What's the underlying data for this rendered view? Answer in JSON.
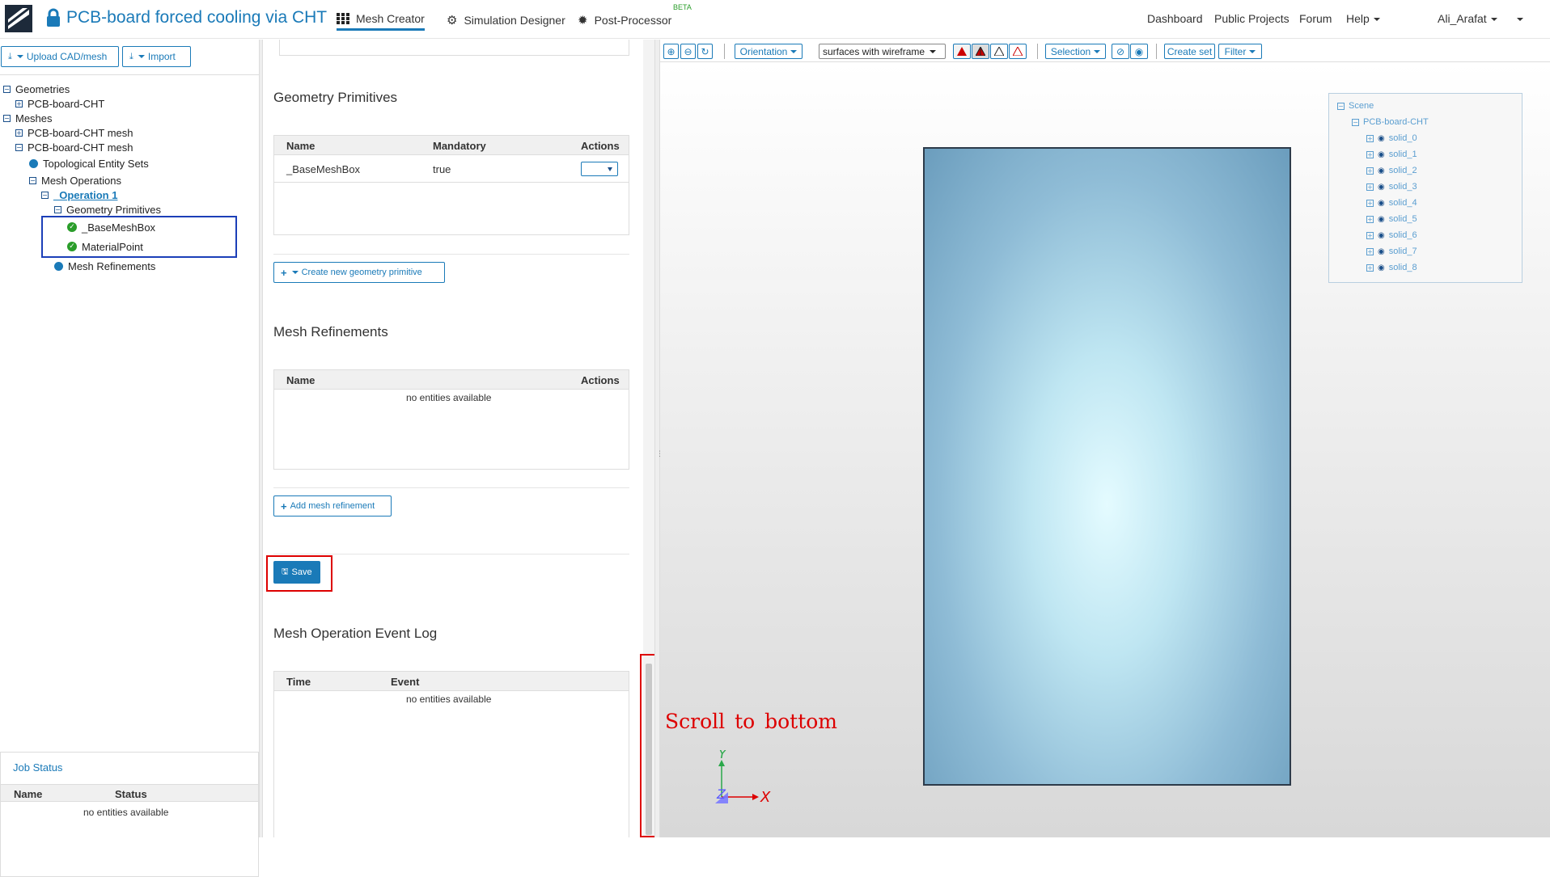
{
  "app": {
    "project_title": "PCB-board forced cooling via CHT",
    "tabs": [
      {
        "label": "Mesh Creator",
        "icon": "grid-icon",
        "active": true
      },
      {
        "label": "Simulation Designer",
        "icon": "gears-icon",
        "active": false
      },
      {
        "label": "Post-Processor",
        "icon": "cog-icon",
        "active": false,
        "badge": "BETA"
      }
    ],
    "nav_right": [
      "Dashboard",
      "Public Projects",
      "Forum",
      "Help"
    ],
    "user": "Ali_Arafat"
  },
  "left": {
    "upload_label": "Upload CAD/mesh",
    "import_label": "Import",
    "tree": {
      "geometries": "Geometries",
      "geometry_item": "PCB-board-CHT",
      "meshes": "Meshes",
      "mesh_1": "PCB-board-CHT mesh",
      "mesh_2": "PCB-board-CHT mesh",
      "topo_sets": "Topological Entity Sets",
      "mesh_operations": "Mesh Operations",
      "operation": "_Operation 1",
      "geometry_primitives": "Geometry Primitives",
      "base_mesh_box": "_BaseMeshBox",
      "material_point": "MaterialPoint",
      "mesh_refinements": "Mesh Refinements"
    },
    "job_status": {
      "title": "Job Status",
      "col_name": "Name",
      "col_status": "Status",
      "empty": "no entities available"
    }
  },
  "middle": {
    "geometry_primitives": {
      "title": "Geometry Primitives",
      "columns": [
        "Name",
        "Mandatory",
        "Actions"
      ],
      "rows": [
        {
          "name": "_BaseMeshBox",
          "mandatory": "true"
        }
      ],
      "create_button": "Create new geometry primitive"
    },
    "mesh_refinements": {
      "title": "Mesh Refinements",
      "columns": [
        "Name",
        "Actions"
      ],
      "empty": "no entities available",
      "add_button": "Add mesh refinement"
    },
    "save_label": "Save",
    "event_log": {
      "title": "Mesh Operation Event Log",
      "columns": [
        "Time",
        "Event"
      ],
      "empty": "no entities available"
    }
  },
  "viewer": {
    "orientation_label": "Orientation",
    "render_mode": "surfaces with wireframe",
    "selection_label": "Selection",
    "create_set_label": "Create set",
    "filter_label": "Filter",
    "scene": {
      "root": "Scene",
      "object": "PCB-board-CHT",
      "solids": [
        "solid_0",
        "solid_1",
        "solid_2",
        "solid_3",
        "solid_4",
        "solid_5",
        "solid_6",
        "solid_7",
        "solid_8"
      ]
    },
    "annotation": "Scroll to bottom",
    "axes": {
      "y": "Y",
      "z": "Z",
      "x": "X"
    },
    "colors": {
      "accent": "#1a7ab8",
      "annotation": "#dd0000",
      "highlight_box": "#1c3fb8"
    }
  }
}
